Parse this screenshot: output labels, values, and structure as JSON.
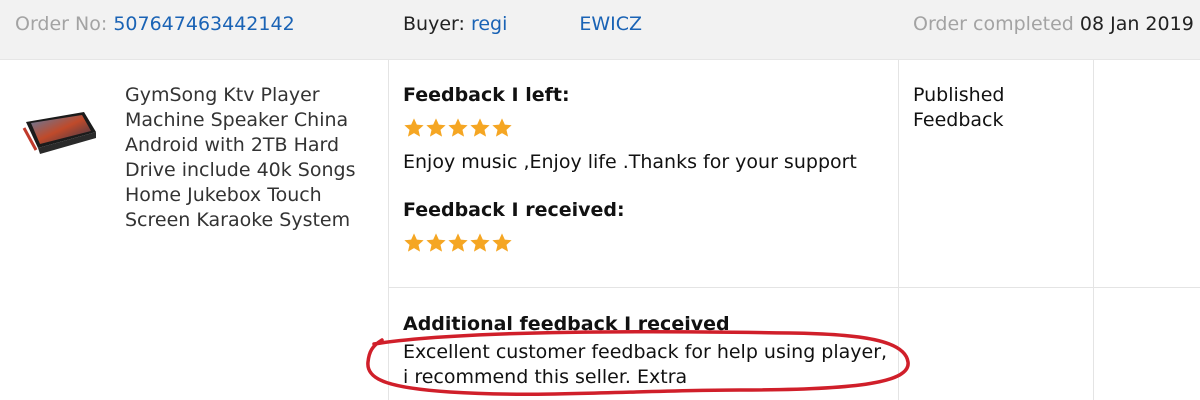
{
  "header": {
    "order_label": "Order No:",
    "order_number": "507647463442142",
    "buyer_label": "Buyer:",
    "buyer_name_start": "regi",
    "buyer_name_end": "EWICZ",
    "completed_label": "Order completed",
    "completed_date": "08 Jan 2019"
  },
  "product": {
    "title": "GymSong Ktv Player Machine Speaker China Android with 2TB Hard Drive include 40k Songs Home Jukebox Touch Screen Karaoke System"
  },
  "feedback": {
    "left_label": "Feedback I left:",
    "left_rating": 5,
    "left_comment": "Enjoy music ,Enjoy life .Thanks for your support",
    "received_label": "Feedback I received:",
    "received_rating": 5,
    "additional_label": "Additional feedback I received",
    "additional_line1": "Excellent customer feedback for help using player,",
    "additional_line2": "i recommend this seller. Extra"
  },
  "status": {
    "text": "Published Feedback"
  },
  "colors": {
    "header_bg": "#f2f2f2",
    "link": "#1a63b5",
    "muted": "#a3a3a3",
    "star": "#f5a623",
    "annotation": "#d01f2a"
  },
  "icons": {
    "rating_star": "star-icon",
    "product_image": "karaoke-tablet-thumbnail"
  }
}
